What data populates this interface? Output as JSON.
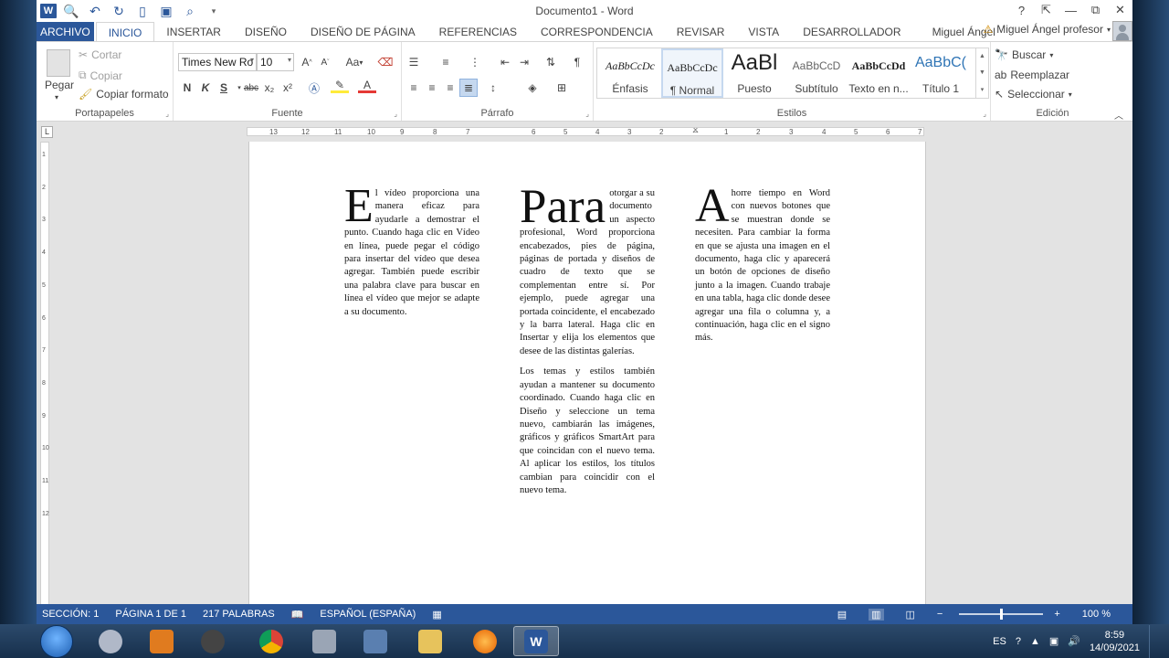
{
  "window": {
    "title": "Documento1 - Word",
    "help": "?",
    "controls": [
      "⇱",
      "—",
      "⧉",
      "✕"
    ]
  },
  "tabs": [
    "ARCHIVO",
    "INICIO",
    "INSERTAR",
    "DISEÑO",
    "DISEÑO DE PÁGINA",
    "REFERENCIAS",
    "CORRESPONDENCIA",
    "REVISAR",
    "VISTA",
    "DESARROLLADOR",
    "Miguel Ángel"
  ],
  "account": {
    "name": "Miguel Ángel profesor",
    "warning": "⚠"
  },
  "clipboard": {
    "label": "Portapapeles",
    "paste": "Pegar",
    "cut": "Cortar",
    "copy": "Copiar",
    "format_painter": "Copiar formato"
  },
  "font": {
    "label": "Fuente",
    "family": "Times New Ro",
    "size": "10",
    "bold": "N",
    "italic": "K",
    "underline": "S",
    "strike": "abc",
    "subscript": "x₂",
    "superscript": "x²",
    "grow": "A",
    "shrink": "A",
    "case": "Aa"
  },
  "paragraph": {
    "label": "Párrafo"
  },
  "styles": {
    "label": "Estilos",
    "items": [
      {
        "preview": "AaBbCcDc",
        "name": "Énfasis"
      },
      {
        "preview": "AaBbCcDc",
        "name": "¶ Normal"
      },
      {
        "preview": "AaBl",
        "name": "Puesto"
      },
      {
        "preview": "AaBbCcD",
        "name": "Subtítulo"
      },
      {
        "preview": "AaBbCcDd",
        "name": "Texto en n..."
      },
      {
        "preview": "AaBbC(",
        "name": "Título 1"
      }
    ]
  },
  "editing": {
    "label": "Edición",
    "find": "Buscar",
    "replace": "Reemplazar",
    "select": "Seleccionar"
  },
  "ruler": {
    "selector": "L",
    "ticks": [
      "13",
      "12",
      "11",
      "10",
      "9",
      "8",
      "7",
      "6",
      "5",
      "4",
      "3",
      "2",
      "1",
      "1",
      "2",
      "3",
      "4",
      "5",
      "6",
      "7"
    ],
    "vticks": [
      "1",
      "2",
      "3",
      "4",
      "5",
      "6",
      "7",
      "8",
      "9",
      "10",
      "11",
      "12"
    ]
  },
  "document": {
    "col1": {
      "drop": "E",
      "text": "l vídeo proporciona una manera eficaz para ayudarle a demostrar el punto. Cuando haga clic en Vídeo en línea, puede pegar el código para insertar del vídeo que desea agregar. También puede escribir una palabra clave para buscar en línea el vídeo que mejor se adapte a su documento."
    },
    "col2": {
      "drop": "Para",
      "text": "otorgar a su documento un aspecto profesional, Word proporciona encabezados, pies de página, páginas de portada y diseños de cuadro de texto que se complementan entre sí. Por ejemplo, puede agregar una portada coincidente, el encabezado y la barra lateral. Haga clic en Insertar y elija los elementos que desee de las distintas galerías.",
      "para2": "Los temas y estilos también ayudan a mantener su documento coordinado. Cuando haga clic en Diseño y seleccione un tema nuevo, cambiarán las imágenes, gráficos y gráficos SmartArt para que coincidan con el nuevo tema. Al aplicar los estilos, los títulos cambian para coincidir con el nuevo tema."
    },
    "col3": {
      "drop": "A",
      "text": "horre tiempo en Word con nuevos botones que se muestran donde se necesiten. Para cambiar la forma en que se ajusta una imagen en el documento, haga clic y aparecerá un botón de opciones de diseño junto a la imagen. Cuando trabaje en una tabla, haga clic donde desee agregar una fila o columna y, a continuación, haga clic en el signo más."
    }
  },
  "statusbar": {
    "section": "SECCIÓN: 1",
    "page": "PÁGINA 1 DE 1",
    "words": "217 PALABRAS",
    "language": "ESPAÑOL (ESPAÑA)",
    "zoom": "100 %"
  },
  "taskbar": {
    "lang": "ES",
    "time": "8:59",
    "date": "14/09/2021"
  },
  "colors": {
    "accent": "#2b579a",
    "taskbar": "#1e3a5c"
  }
}
